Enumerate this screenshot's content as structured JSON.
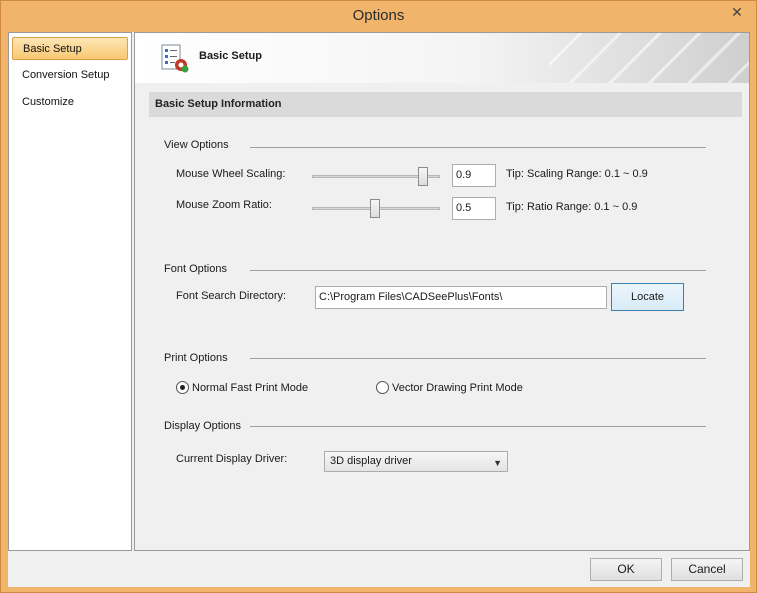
{
  "window": {
    "title": "Options",
    "close_glyph": "✕"
  },
  "sidebar": {
    "items": [
      {
        "label": "Basic Setup",
        "active": true
      },
      {
        "label": "Conversion Setup",
        "active": false
      },
      {
        "label": "Customize",
        "active": false
      }
    ]
  },
  "banner": {
    "title": "Basic Setup",
    "icon": "settings-list-icon"
  },
  "section": {
    "title": "Basic Setup Information"
  },
  "view_options": {
    "label": "View Options",
    "wheel": {
      "label": "Mouse Wheel Scaling:",
      "value": "0.9",
      "tip": "Tip: Scaling Range: 0.1 ~ 0.9"
    },
    "zoom": {
      "label": "Mouse Zoom Ratio:",
      "value": "0.5",
      "tip": "Tip: Ratio Range: 0.1 ~ 0.9"
    }
  },
  "font_options": {
    "label": "Font Options",
    "dir_label": "Font Search Directory:",
    "dir_value": "C:\\Program Files\\CADSeePlus\\Fonts\\",
    "locate_label": "Locate"
  },
  "print_options": {
    "label": "Print Options",
    "normal": "Normal Fast Print Mode",
    "vector": "Vector Drawing Print Mode",
    "selected": "normal"
  },
  "display_options": {
    "label": "Display Options",
    "driver_label": "Current Display Driver:",
    "driver_value": "3D display driver"
  },
  "footer": {
    "ok": "OK",
    "cancel": "Cancel"
  },
  "colors": {
    "frame": "#f0b46a",
    "active_item": "#f8c873"
  }
}
